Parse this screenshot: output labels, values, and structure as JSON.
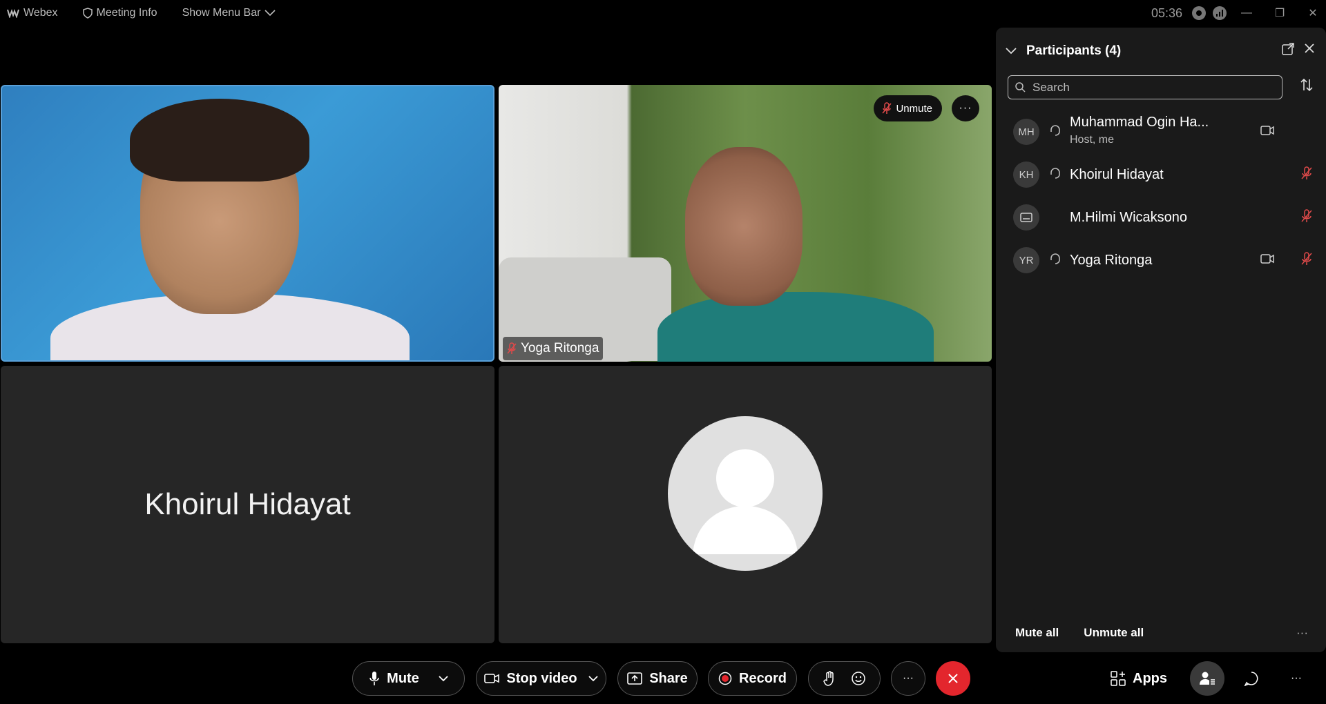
{
  "app": {
    "name": "Webex",
    "meeting_info": "Meeting Info",
    "show_menu_bar": "Show Menu Bar",
    "time": "05:36"
  },
  "tiles": {
    "yoga": {
      "unmute_label": "Unmute",
      "more_label": "···",
      "name": "Yoga Ritonga"
    },
    "khoirul": {
      "name": "Khoirul Hidayat"
    }
  },
  "participants_panel": {
    "title": "Participants (4)",
    "search_placeholder": "Search",
    "items": [
      {
        "initials": "MH",
        "name": "Muhammad Ogin Ha...",
        "subtitle": "Host, me"
      },
      {
        "initials": "KH",
        "name": "Khoirul Hidayat",
        "subtitle": ""
      },
      {
        "initials": "",
        "name": "M.Hilmi Wicaksono",
        "subtitle": ""
      },
      {
        "initials": "YR",
        "name": "Yoga Ritonga",
        "subtitle": ""
      }
    ],
    "mute_all": "Mute all",
    "unmute_all": "Unmute all",
    "more": "···"
  },
  "toolbar": {
    "mute": "Mute",
    "stop_video": "Stop video",
    "share": "Share",
    "record": "Record",
    "more": "···",
    "apps": "Apps"
  },
  "colors": {
    "end_call": "#e3262d",
    "muted_icon": "#e04a4a",
    "panel_bg": "#1a1a1a",
    "tile_bg": "#262626"
  },
  "icons": [
    "webex-logo-icon",
    "shield-icon",
    "chevron-down-icon",
    "record-indicator-icon",
    "signal-icon",
    "mic-off-icon",
    "headset-icon",
    "camera-icon",
    "popout-icon",
    "close-icon",
    "sort-icon",
    "search-icon",
    "mic-icon",
    "video-icon",
    "share-icon",
    "record-icon",
    "raise-hand-icon",
    "reactions-icon",
    "end-call-icon",
    "apps-icon",
    "participants-icon",
    "chat-icon"
  ]
}
